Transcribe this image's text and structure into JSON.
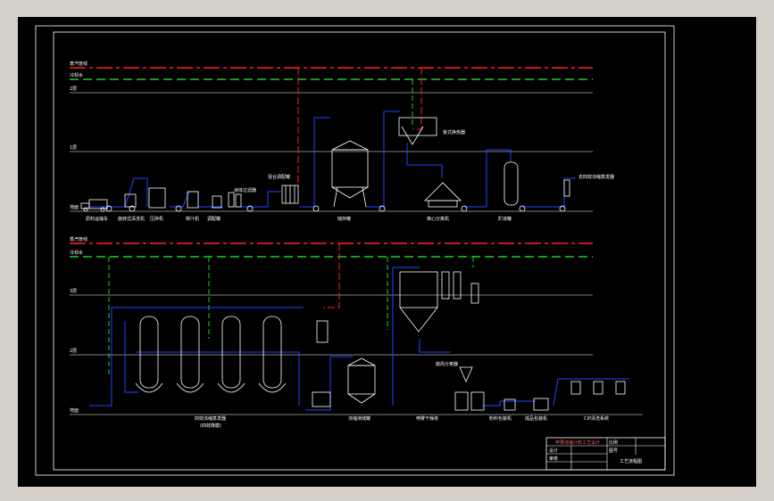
{
  "colors": {
    "window_bg": "#d4d0c8",
    "drawing_bg": "#000000",
    "frame": "#ffffff",
    "steam": "#ff2020",
    "water": "#22cc22",
    "process": "#2244ff",
    "equipment": "#ffffff",
    "title_block": "#ff4040"
  },
  "top_section": {
    "line_labels": [
      "蒸汽管线",
      "冷却水",
      "2层",
      "1层",
      "地面"
    ],
    "equipment_labels": [
      "原料运输车",
      "旋转式清洗机",
      "压碎机",
      "榨汁机",
      "调配罐",
      "液体过滤器",
      "混合调配罐",
      "储存罐",
      "离心分离机",
      "贮液罐",
      "板式换热器",
      "去四效浓缩蒸发器"
    ]
  },
  "bottom_section": {
    "line_labels": [
      "蒸汽管线",
      "冷却水",
      "3层",
      "2层",
      "地面"
    ],
    "equipment_labels": [
      "四效浓缩蒸发器",
      "(四效降膜)",
      "浓缩液储罐",
      "喷雾干燥塔",
      "旋风分离器",
      "粉料包装机",
      "成品包装机",
      "CIP清洗系统"
    ]
  },
  "title_block": {
    "title": "苹果浓缩汁粉工艺设计",
    "cells": [
      "设计",
      "审核",
      "比例",
      "图号",
      "工艺流程图"
    ]
  }
}
